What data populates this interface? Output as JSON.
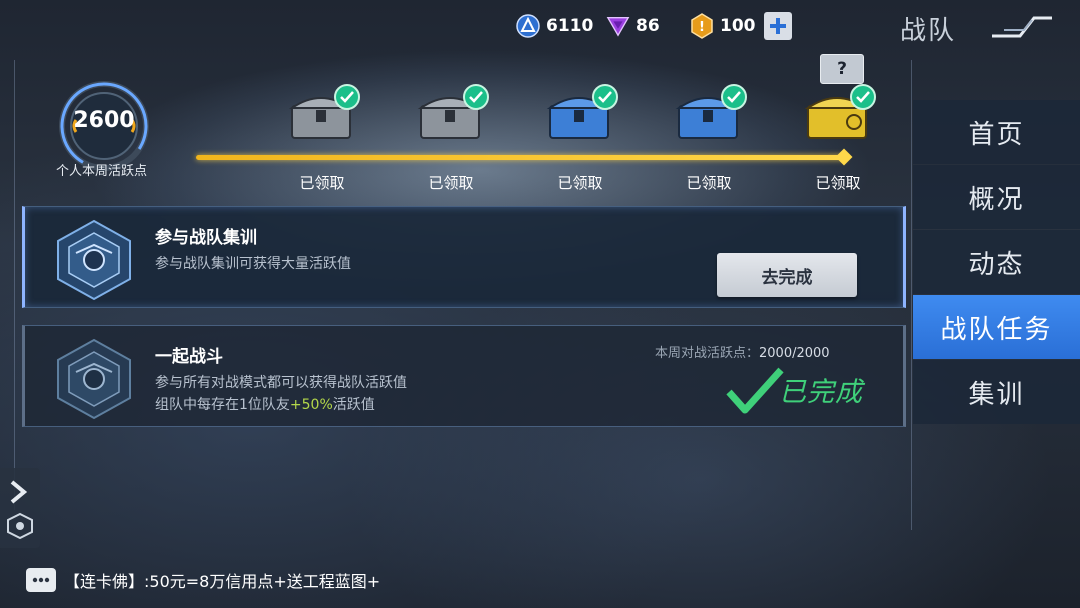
{
  "header": {
    "currencies": [
      {
        "icon": "crystal-coin-icon",
        "value": "6110"
      },
      {
        "icon": "purple-gem-icon",
        "value": "86"
      },
      {
        "icon": "gold-badge-icon",
        "value": "100"
      }
    ],
    "title": "战队"
  },
  "activity": {
    "points": "2600",
    "label": "个人本周活跃点",
    "progress_fraction": 1.0
  },
  "chests": [
    {
      "label": "已领取",
      "color": "#8d949c",
      "claimed": true
    },
    {
      "label": "已领取",
      "color": "#8d949c",
      "claimed": true
    },
    {
      "label": "已领取",
      "color": "#3d7fd6",
      "claimed": true
    },
    {
      "label": "已领取",
      "color": "#3d7fd6",
      "claimed": true
    },
    {
      "label": "已领取",
      "color": "#e2bf2a",
      "claimed": true
    }
  ],
  "mystery_label": "?",
  "tasks": [
    {
      "title": "参与战队集训",
      "desc": "参与战队集训可获得大量活跃值",
      "button": "去完成"
    },
    {
      "title": "一起战斗",
      "desc": "参与所有对战模式都可以获得战队活跃值",
      "desc2_prefix": "组队中每存在1位队友",
      "desc2_bonus": "+50%",
      "desc2_suffix": "活跃值",
      "progress_label": "本周对战活跃点：",
      "progress_value": "2000/2000",
      "status": "已完成"
    }
  ],
  "nav": {
    "items": [
      "首页",
      "概况",
      "动态",
      "战队任务",
      "集训"
    ],
    "selected_index": 3
  },
  "chat": {
    "text": "【连卡佛】:50元=8万信用点+送工程蓝图+"
  },
  "colors": {
    "accent_blue": "#3f8bf0",
    "progress_gold": "#f1b51c",
    "complete_green": "#3fd07a"
  }
}
